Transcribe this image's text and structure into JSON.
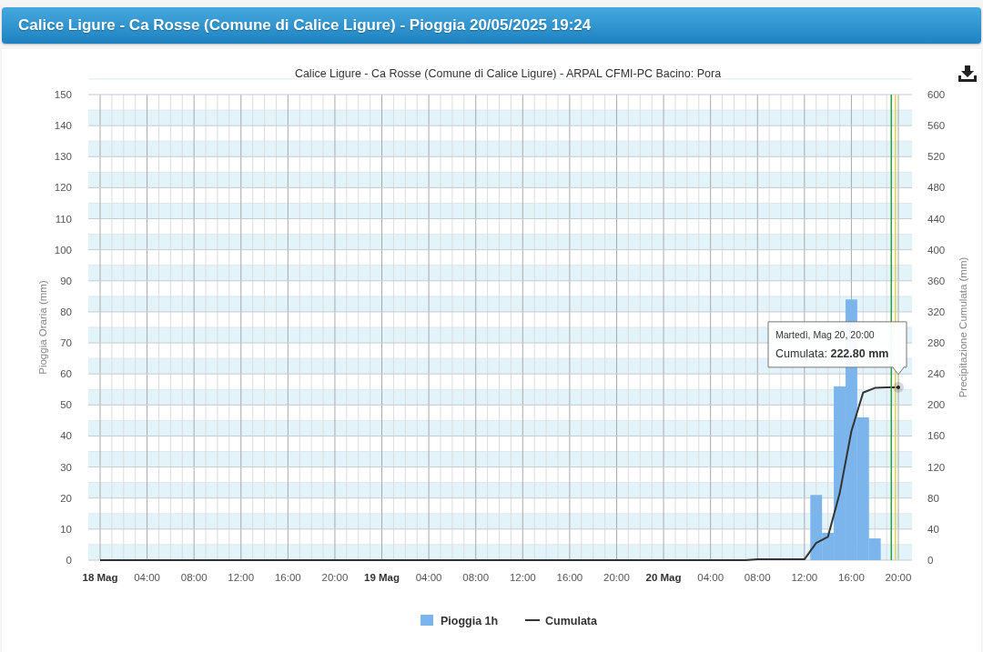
{
  "header": {
    "title": "Calice Ligure - Ca Rosse (Comune di Calice Ligure) - Pioggia 20/05/2025 19:24"
  },
  "chart": {
    "chart_data": {
      "type": "bar",
      "title": "Calice Ligure - Ca Rosse (Comune di Calice Ligure) - ARPAL CFMI-PC Bacino: Pora",
      "ylabel": "Pioggia Oraria (mm)",
      "y2label": "Precipitazione Cumulata (mm)",
      "ylim": [
        0,
        150
      ],
      "y2lim": [
        0,
        600
      ],
      "grid": true,
      "yticks": [
        0,
        10,
        20,
        30,
        40,
        50,
        60,
        70,
        80,
        90,
        100,
        110,
        120,
        130,
        140,
        150
      ],
      "y2ticks": [
        0,
        40,
        80,
        120,
        160,
        200,
        240,
        280,
        320,
        360,
        400,
        440,
        480,
        520,
        560,
        600
      ],
      "xlim": [
        "2025-05-18 00:00",
        "2025-05-20 20:00"
      ],
      "xticks": [
        {
          "value": "2025-05-18 00:00",
          "label": "18 Mag"
        },
        {
          "value": "2025-05-18 04:00",
          "label": "04:00"
        },
        {
          "value": "2025-05-18 08:00",
          "label": "08:00"
        },
        {
          "value": "2025-05-18 12:00",
          "label": "12:00"
        },
        {
          "value": "2025-05-18 16:00",
          "label": "16:00"
        },
        {
          "value": "2025-05-18 20:00",
          "label": "20:00"
        },
        {
          "value": "2025-05-19 00:00",
          "label": "19 Mag"
        },
        {
          "value": "2025-05-19 04:00",
          "label": "04:00"
        },
        {
          "value": "2025-05-19 08:00",
          "label": "08:00"
        },
        {
          "value": "2025-05-19 12:00",
          "label": "12:00"
        },
        {
          "value": "2025-05-19 16:00",
          "label": "16:00"
        },
        {
          "value": "2025-05-19 20:00",
          "label": "20:00"
        },
        {
          "value": "2025-05-20 00:00",
          "label": "20 Mag"
        },
        {
          "value": "2025-05-20 04:00",
          "label": "04:00"
        },
        {
          "value": "2025-05-20 08:00",
          "label": "08:00"
        },
        {
          "value": "2025-05-20 12:00",
          "label": "12:00"
        },
        {
          "value": "2025-05-20 16:00",
          "label": "16:00"
        },
        {
          "value": "2025-05-20 20:00",
          "label": "20:00"
        }
      ],
      "x": [
        "2025-05-18 00:00",
        "2025-05-18 01:00",
        "2025-05-18 02:00",
        "2025-05-18 03:00",
        "2025-05-18 04:00",
        "2025-05-18 05:00",
        "2025-05-18 06:00",
        "2025-05-18 07:00",
        "2025-05-18 08:00",
        "2025-05-18 09:00",
        "2025-05-18 10:00",
        "2025-05-18 11:00",
        "2025-05-18 12:00",
        "2025-05-18 13:00",
        "2025-05-18 14:00",
        "2025-05-18 15:00",
        "2025-05-18 16:00",
        "2025-05-18 17:00",
        "2025-05-18 18:00",
        "2025-05-18 19:00",
        "2025-05-18 20:00",
        "2025-05-18 21:00",
        "2025-05-18 22:00",
        "2025-05-18 23:00",
        "2025-05-19 00:00",
        "2025-05-19 01:00",
        "2025-05-19 02:00",
        "2025-05-19 03:00",
        "2025-05-19 04:00",
        "2025-05-19 05:00",
        "2025-05-19 06:00",
        "2025-05-19 07:00",
        "2025-05-19 08:00",
        "2025-05-19 09:00",
        "2025-05-19 10:00",
        "2025-05-19 11:00",
        "2025-05-19 12:00",
        "2025-05-19 13:00",
        "2025-05-19 14:00",
        "2025-05-19 15:00",
        "2025-05-19 16:00",
        "2025-05-19 17:00",
        "2025-05-19 18:00",
        "2025-05-19 19:00",
        "2025-05-19 20:00",
        "2025-05-19 21:00",
        "2025-05-19 22:00",
        "2025-05-19 23:00",
        "2025-05-20 00:00",
        "2025-05-20 01:00",
        "2025-05-20 02:00",
        "2025-05-20 03:00",
        "2025-05-20 04:00",
        "2025-05-20 05:00",
        "2025-05-20 06:00",
        "2025-05-20 07:00",
        "2025-05-20 08:00",
        "2025-05-20 09:00",
        "2025-05-20 10:00",
        "2025-05-20 11:00",
        "2025-05-20 12:00",
        "2025-05-20 13:00",
        "2025-05-20 14:00",
        "2025-05-20 15:00",
        "2025-05-20 16:00",
        "2025-05-20 17:00",
        "2025-05-20 18:00",
        "2025-05-20 19:00",
        "2025-05-20 20:00"
      ],
      "series": [
        {
          "name": "Pioggia 1h",
          "color": "#7cb5ec",
          "values": [
            0,
            0,
            0,
            0,
            0,
            0,
            0,
            0,
            0,
            0,
            0,
            0,
            0,
            0,
            0,
            0,
            0,
            0,
            0,
            0,
            0,
            0,
            0,
            0,
            0,
            0,
            0,
            0,
            0,
            0,
            0,
            0,
            0,
            0,
            0,
            0,
            0,
            0,
            0,
            0,
            0,
            0,
            0,
            0,
            0,
            0,
            0,
            0,
            0,
            0,
            0,
            0,
            0,
            0,
            0,
            0,
            0,
            0,
            0,
            0,
            0,
            21,
            8.8,
            56,
            84,
            46,
            7,
            0,
            0
          ]
        },
        {
          "name": "Cumulata",
          "type": "line",
          "axis": "y2",
          "color": "#333333",
          "values": [
            0,
            0,
            0,
            0,
            0,
            0,
            0,
            0,
            0,
            0,
            0,
            0,
            0,
            0,
            0,
            0,
            0,
            0,
            0,
            0,
            0,
            0,
            0,
            0,
            0,
            0,
            0,
            0,
            0,
            0,
            0,
            0,
            0,
            0,
            0,
            0,
            0,
            0,
            0,
            0,
            0,
            0,
            0,
            0,
            0,
            0,
            0,
            0,
            0,
            0,
            0,
            0,
            0,
            0,
            0,
            0,
            1,
            1,
            1,
            1,
            1,
            22,
            30,
            86,
            166,
            216,
            222,
            222.8,
            222.8
          ]
        }
      ],
      "bands": [
        {
          "axis": "y",
          "from": 0,
          "to": 5,
          "color": "#e3f3fa"
        },
        {
          "axis": "y",
          "from": 10,
          "to": 15,
          "color": "#e3f3fa"
        },
        {
          "axis": "y",
          "from": 20,
          "to": 25,
          "color": "#e3f3fa"
        },
        {
          "axis": "y",
          "from": 30,
          "to": 35,
          "color": "#e3f3fa"
        },
        {
          "axis": "y",
          "from": 40,
          "to": 45,
          "color": "#e3f3fa"
        },
        {
          "axis": "y",
          "from": 50,
          "to": 55,
          "color": "#e3f3fa"
        },
        {
          "axis": "y",
          "from": 60,
          "to": 65,
          "color": "#e3f3fa"
        },
        {
          "axis": "y",
          "from": 70,
          "to": 75,
          "color": "#e3f3fa"
        },
        {
          "axis": "y",
          "from": 80,
          "to": 85,
          "color": "#e3f3fa"
        },
        {
          "axis": "y",
          "from": 90,
          "to": 95,
          "color": "#e3f3fa"
        },
        {
          "axis": "y",
          "from": 100,
          "to": 105,
          "color": "#e3f3fa"
        },
        {
          "axis": "y",
          "from": 110,
          "to": 115,
          "color": "#e3f3fa"
        },
        {
          "axis": "y",
          "from": 120,
          "to": 125,
          "color": "#e3f3fa"
        },
        {
          "axis": "y",
          "from": 130,
          "to": 135,
          "color": "#e3f3fa"
        },
        {
          "axis": "y",
          "from": 140,
          "to": 145,
          "color": "#e3f3fa"
        }
      ],
      "ref_lines": [
        {
          "axis": "x",
          "value": "2025-05-20 19:24",
          "color": "#2e9e3e"
        },
        {
          "axis": "x",
          "value": "2025-05-20 19:45",
          "color": "#e8d34a"
        }
      ],
      "legend": true,
      "annotations": [
        "Martedì, Mag 20, 20:00",
        "Cumulata: **222.80 mm**"
      ]
    }
  }
}
